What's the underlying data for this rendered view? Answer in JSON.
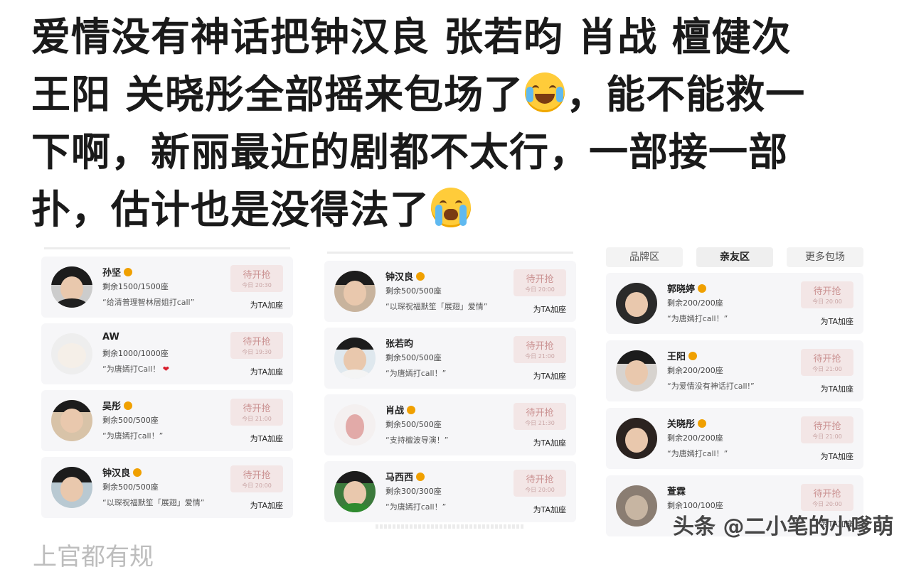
{
  "post": {
    "lines": [
      {
        "a": "爱情没有神话把钟汉良 张若昀 肖战 檀健次",
        "emoji": "",
        "b": ""
      },
      {
        "a": "王阳 关晓彤全部摇来包场了",
        "emoji": "laughing-tears",
        "b": "，能不能救一"
      },
      {
        "a": "下啊，新丽最近的剧都不太行，一部接一部",
        "emoji": "",
        "b": ""
      },
      {
        "a": "扑，估计也是没得法了",
        "emoji": "loudly-crying",
        "b": ""
      }
    ]
  },
  "colors": {
    "status_bg": "#f3e6e6",
    "status_text": "#c98f8f",
    "badge": "#f0a000",
    "card_bg": "#f6f6f8"
  },
  "tabs": [
    "品牌区",
    "亲友区",
    "更多包场"
  ],
  "col1": [
    {
      "name": "孙坚",
      "seats": "剩余1500/1500座",
      "slogan": "“给清普理智林居姐打call”",
      "status": "待开抢",
      "time": "今日 20:30",
      "action": "为TA加座"
    },
    {
      "name": "AW",
      "seats": "剩余1000/1000座",
      "slogan": "“为唐嫣打Call！",
      "heart": "❤",
      "status": "待开抢",
      "time": "今日 19:30",
      "action": "为TA加座"
    },
    {
      "name": "吴彤",
      "seats": "剩余500/500座",
      "slogan": "“为唐嫣打call！”",
      "status": "待开抢",
      "time": "今日 21:00",
      "action": "为TA加座"
    },
    {
      "name": "钟汉良",
      "seats": "剩余500/500座",
      "slogan": "“以琛祝福默笙「展翅」爱情”",
      "status": "待开抢",
      "time": "今日 20:00",
      "action": "为TA加座"
    }
  ],
  "col2": [
    {
      "name": "钟汉良",
      "seats": "剩余500/500座",
      "slogan": "“以琛祝福默笙「展翅」爱情”",
      "status": "待开抢",
      "time": "今日 20:00",
      "action": "为TA加座"
    },
    {
      "name": "张若昀",
      "seats": "剩余500/500座",
      "slogan": "“为唐嫣打call！”",
      "status": "待开抢",
      "time": "今日 21:00",
      "action": "为TA加座"
    },
    {
      "name": "肖战",
      "seats": "剩余500/500座",
      "slogan": "“支持檀波导演！”",
      "status": "待开抢",
      "time": "今日 21:30",
      "action": "为TA加座"
    },
    {
      "name": "马西西",
      "seats": "剩余300/300座",
      "slogan": "“为唐嫣打call！”",
      "status": "待开抢",
      "time": "今日 20:00",
      "action": "为TA加座"
    }
  ],
  "col3": [
    {
      "name": "郭晓婷",
      "seats": "剩余200/200座",
      "slogan": "“为唐嫣打call！”",
      "status": "待开抢",
      "time": "今日 20:00",
      "action": "为TA加座"
    },
    {
      "name": "王阳",
      "seats": "剩余200/200座",
      "slogan": "“为爱情没有神话打call!”",
      "status": "待开抢",
      "time": "今日 21:00",
      "action": "为TA加座"
    },
    {
      "name": "关晓彤",
      "seats": "剩余200/200座",
      "slogan": "“为唐嫣打call！”",
      "status": "待开抢",
      "time": "今日 21:00",
      "action": "为TA加座"
    },
    {
      "name": "萱霖",
      "seats": "剩余100/100座",
      "slogan": "",
      "status": "待开抢",
      "time": "今日 20:00",
      "action": "为TA加座"
    }
  ],
  "watermark": "头条 @二小笔的小嗲萌",
  "bottom_cut": "上官都有规"
}
